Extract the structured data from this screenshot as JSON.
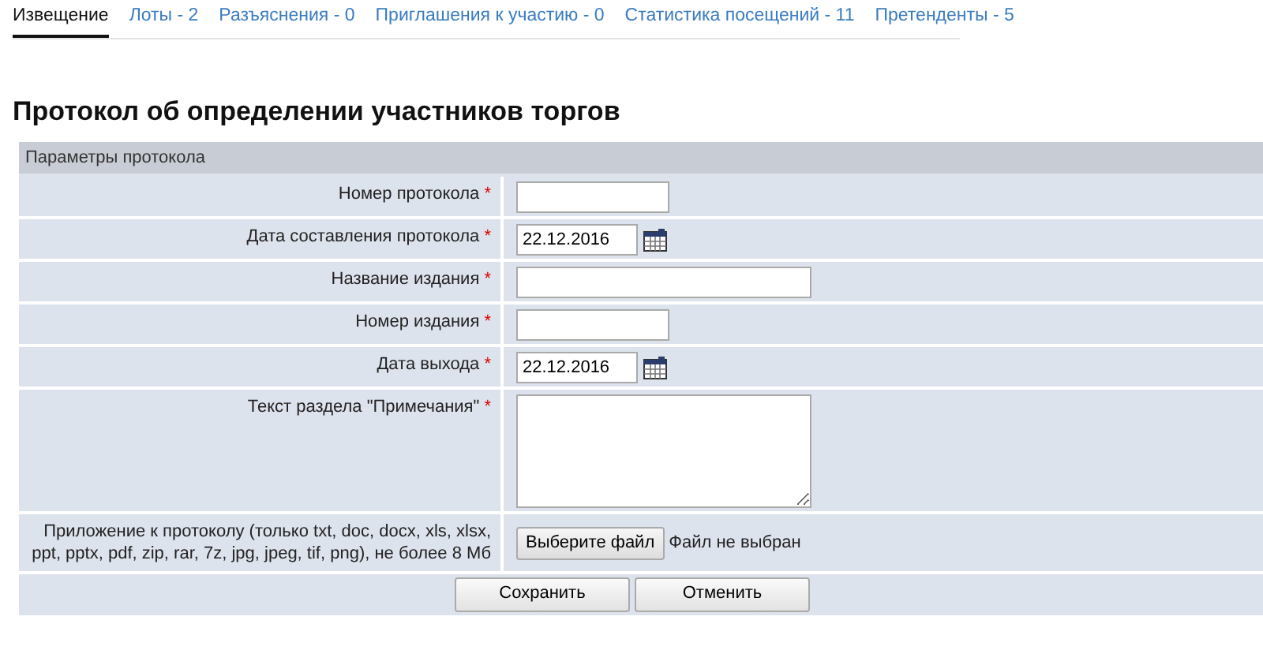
{
  "tabs": [
    {
      "label": "Извещение",
      "selected": true
    },
    {
      "label": "Лоты - 2",
      "selected": false
    },
    {
      "label": "Разъяснения - 0",
      "selected": false
    },
    {
      "label": "Приглашения к участию - 0",
      "selected": false
    },
    {
      "label": "Статистика посещений - 11",
      "selected": false
    },
    {
      "label": "Претенденты - 5",
      "selected": false
    }
  ],
  "page_title": "Протокол об определении участников торгов",
  "section_header": "Параметры протокола",
  "fields": [
    {
      "label": "Номер протокола",
      "required_mark": "*",
      "kind": "short"
    },
    {
      "label": "Дата составления протокола",
      "required_mark": "*",
      "kind": "date",
      "value": "22.12.2016"
    },
    {
      "label": "Название издания",
      "required_mark": "*",
      "kind": "long"
    },
    {
      "label": "Номер издания",
      "required_mark": "*",
      "kind": "short"
    },
    {
      "label": "Дата выхода",
      "required_mark": "*",
      "kind": "date",
      "value": "22.12.2016"
    },
    {
      "label": "Текст раздела \"Примечания\"",
      "required_mark": "*",
      "kind": "textarea"
    },
    {
      "label": "Приложение к протоколу (только txt, doc, docx, xls, xlsx, ppt, pptx, pdf, zip, rar, 7z, jpg, jpeg, tif, png), не более 8 Мб",
      "kind": "file",
      "button": "Выберите файл",
      "status": "Файл не выбран"
    }
  ],
  "buttons": [
    "Сохранить",
    "Отменить"
  ]
}
